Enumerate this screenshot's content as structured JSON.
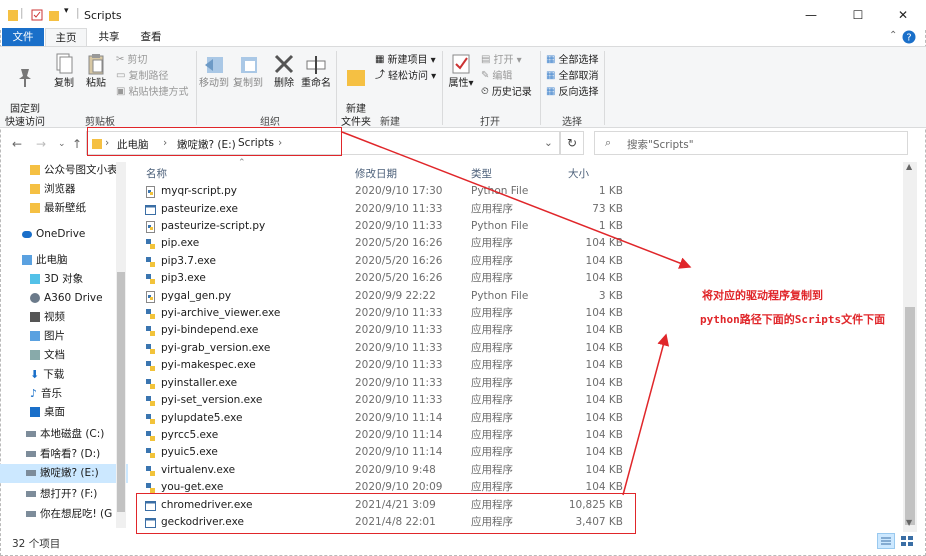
{
  "window": {
    "title": "Scripts",
    "minimize": "—",
    "maximize": "☐",
    "close": "✕"
  },
  "ribbon_tabs": [
    "文件",
    "主页",
    "共享",
    "查看"
  ],
  "ribbon": {
    "clipboard": {
      "pin": "固定到\n快速访问",
      "copy": "复制",
      "paste": "粘贴",
      "cut": "剪切",
      "copy_path": "复制路径",
      "paste_shortcut": "粘贴快捷方式",
      "group": "剪贴板"
    },
    "organize": {
      "move_to": "移动到",
      "copy_to": "复制到",
      "delete": "删除",
      "rename": "重命名",
      "group": "组织"
    },
    "new": {
      "new_folder": "新建\n文件夹",
      "new_item": "新建项目",
      "easy_access": "轻松访问",
      "group": "新建"
    },
    "open": {
      "properties": "属性",
      "open": "打开",
      "edit": "编辑",
      "history": "历史记录",
      "group": "打开"
    },
    "select": {
      "select_all": "全部选择",
      "select_none": "全部取消",
      "invert": "反向选择",
      "group": "选择"
    }
  },
  "address": {
    "crumbs": [
      "此电脑",
      "嫩啶嫩? (E:)",
      "Scripts"
    ]
  },
  "search": {
    "placeholder": "搜索\"Scripts\""
  },
  "sidebar": [
    {
      "label": "公众号图文小表",
      "icon": "folder-icon",
      "selected": false
    },
    {
      "label": "浏览器",
      "icon": "folder-icon",
      "selected": false
    },
    {
      "label": "最新壁纸",
      "icon": "folder-icon",
      "selected": false
    },
    {
      "label": "OneDrive",
      "icon": "cloud-icon",
      "selected": false
    },
    {
      "label": "此电脑",
      "icon": "computer-icon",
      "selected": false
    },
    {
      "label": "3D 对象",
      "icon": "cube-icon",
      "selected": false
    },
    {
      "label": "A360 Drive",
      "icon": "drive-icon",
      "selected": false
    },
    {
      "label": "视频",
      "icon": "video-icon",
      "selected": false
    },
    {
      "label": "图片",
      "icon": "picture-icon",
      "selected": false
    },
    {
      "label": "文档",
      "icon": "document-icon",
      "selected": false
    },
    {
      "label": "下载",
      "icon": "download-icon",
      "selected": false
    },
    {
      "label": "音乐",
      "icon": "music-icon",
      "selected": false
    },
    {
      "label": "桌面",
      "icon": "desktop-icon",
      "selected": false
    },
    {
      "label": "本地磁盘 (C:)",
      "icon": "disk-icon",
      "selected": false
    },
    {
      "label": "看啥看? (D:)",
      "icon": "disk-icon",
      "selected": false
    },
    {
      "label": "嫩啶嫩? (E:)",
      "icon": "disk-icon",
      "selected": true
    },
    {
      "label": "想打开? (F:)",
      "icon": "disk-icon",
      "selected": false
    },
    {
      "label": "你在想屁吃! (G",
      "icon": "disk-icon",
      "selected": false
    }
  ],
  "columns": {
    "name": "名称",
    "date": "修改日期",
    "type": "类型",
    "size": "大小"
  },
  "files": [
    {
      "name": "myqr-script.py",
      "date": "2020/9/10 17:30",
      "type": "Python File",
      "size": "1 KB",
      "icon": "python-file-icon"
    },
    {
      "name": "pasteurize.exe",
      "date": "2020/9/10 11:33",
      "type": "应用程序",
      "size": "73 KB",
      "icon": "exe-icon"
    },
    {
      "name": "pasteurize-script.py",
      "date": "2020/9/10 11:33",
      "type": "Python File",
      "size": "1 KB",
      "icon": "python-file-icon"
    },
    {
      "name": "pip.exe",
      "date": "2020/5/20 16:26",
      "type": "应用程序",
      "size": "104 KB",
      "icon": "python-exe-icon"
    },
    {
      "name": "pip3.7.exe",
      "date": "2020/5/20 16:26",
      "type": "应用程序",
      "size": "104 KB",
      "icon": "python-exe-icon"
    },
    {
      "name": "pip3.exe",
      "date": "2020/5/20 16:26",
      "type": "应用程序",
      "size": "104 KB",
      "icon": "python-exe-icon"
    },
    {
      "name": "pygal_gen.py",
      "date": "2020/9/9 22:22",
      "type": "Python File",
      "size": "3 KB",
      "icon": "python-file-icon"
    },
    {
      "name": "pyi-archive_viewer.exe",
      "date": "2020/9/10 11:33",
      "type": "应用程序",
      "size": "104 KB",
      "icon": "python-exe-icon"
    },
    {
      "name": "pyi-bindepend.exe",
      "date": "2020/9/10 11:33",
      "type": "应用程序",
      "size": "104 KB",
      "icon": "python-exe-icon"
    },
    {
      "name": "pyi-grab_version.exe",
      "date": "2020/9/10 11:33",
      "type": "应用程序",
      "size": "104 KB",
      "icon": "python-exe-icon"
    },
    {
      "name": "pyi-makespec.exe",
      "date": "2020/9/10 11:33",
      "type": "应用程序",
      "size": "104 KB",
      "icon": "python-exe-icon"
    },
    {
      "name": "pyinstaller.exe",
      "date": "2020/9/10 11:33",
      "type": "应用程序",
      "size": "104 KB",
      "icon": "python-exe-icon"
    },
    {
      "name": "pyi-set_version.exe",
      "date": "2020/9/10 11:33",
      "type": "应用程序",
      "size": "104 KB",
      "icon": "python-exe-icon"
    },
    {
      "name": "pylupdate5.exe",
      "date": "2020/9/10 11:14",
      "type": "应用程序",
      "size": "104 KB",
      "icon": "python-exe-icon"
    },
    {
      "name": "pyrcc5.exe",
      "date": "2020/9/10 11:14",
      "type": "应用程序",
      "size": "104 KB",
      "icon": "python-exe-icon"
    },
    {
      "name": "pyuic5.exe",
      "date": "2020/9/10 11:14",
      "type": "应用程序",
      "size": "104 KB",
      "icon": "python-exe-icon"
    },
    {
      "name": "virtualenv.exe",
      "date": "2020/9/10 9:48",
      "type": "应用程序",
      "size": "104 KB",
      "icon": "python-exe-icon"
    },
    {
      "name": "you-get.exe",
      "date": "2020/9/10 20:09",
      "type": "应用程序",
      "size": "104 KB",
      "icon": "python-exe-icon"
    },
    {
      "name": "chromedriver.exe",
      "date": "2021/4/21 3:09",
      "type": "应用程序",
      "size": "10,825 KB",
      "icon": "exe-icon"
    },
    {
      "name": "geckodriver.exe",
      "date": "2021/4/8 22:01",
      "type": "应用程序",
      "size": "3,407 KB",
      "icon": "exe-icon"
    }
  ],
  "status": {
    "count": "32 个项目"
  },
  "annotation": {
    "line1": "将对应的驱动程序复制到",
    "line2": "python路径下面的Scripts文件下面",
    "color": "#e0262a"
  },
  "colors": {
    "accent": "#1a6fc9",
    "selected": "#cce8ff"
  }
}
